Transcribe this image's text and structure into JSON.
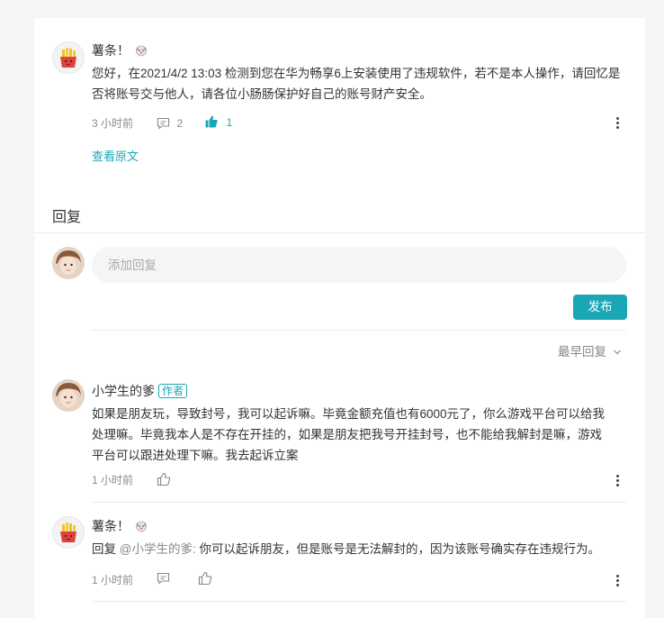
{
  "colors": {
    "accent": "#1aa7b5",
    "page_bg": "#f4f5f7",
    "card_bg": "#ffffff"
  },
  "post": {
    "author": "薯条！",
    "author_emoji_icon": "dog-face-icon",
    "avatar_icon": "french-fries-avatar",
    "text": "您好，在2021/4/2 13:03 检测到您在华为畅享6上安装使用了违规软件，若不是本人操作，请回忆是否将账号交与他人，请各位小肠肠保护好自己的账号财产安全。",
    "time": "3 小时前",
    "comment_count": "2",
    "like_count": "1",
    "view_original": "查看原文"
  },
  "replies_section": {
    "title": "回复",
    "input_placeholder": "添加回复",
    "submit_label": "发布",
    "sort_label": "最早回复"
  },
  "replies": [
    {
      "author": "小学生的爹",
      "badge": "作者",
      "avatar_icon": "child-photo-avatar",
      "line1": "如果是朋友玩，导致封号，我可以起诉嘛。毕竟金额充值也有6000元了，你么游戏平台可以给我",
      "line2": "处理嘛。毕竟我本人是不存在开挂的，如果是朋友把我号开挂封号，也不能给我解封是嘛，游戏",
      "line3": "平台可以跟进处理下嘛。我去起诉立案",
      "time": "1 小时前"
    },
    {
      "author": "薯条！",
      "author_emoji_icon": "dog-face-icon",
      "avatar_icon": "french-fries-avatar",
      "reply_prefix": "回复",
      "mention": "@小学生的爹:",
      "text": "你可以起诉朋友，但是账号是无法解封的，因为该账号确实存在违规行为。",
      "time": "1 小时前"
    }
  ]
}
